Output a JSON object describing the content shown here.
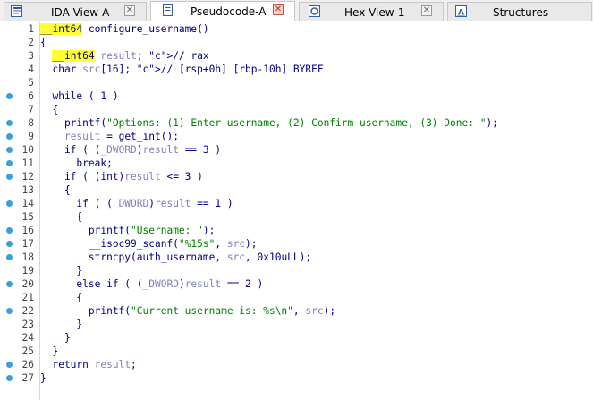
{
  "tabs": [
    {
      "label": "IDA View-A",
      "icon": "ida-view-icon",
      "active": false
    },
    {
      "label": "Pseudocode-A",
      "icon": "pseudocode-icon",
      "active": true
    },
    {
      "label": "Hex View-1",
      "icon": "hex-view-icon",
      "active": false
    },
    {
      "label": "Structures",
      "icon": "structures-icon",
      "active": false
    }
  ],
  "code": {
    "highlight_color": "#ffff33",
    "breakpoint_color": "#3aa0d8",
    "lines": [
      {
        "num": "1",
        "dot": false,
        "text": "__int64 configure_username()"
      },
      {
        "num": "2",
        "dot": false,
        "text": "{"
      },
      {
        "num": "3",
        "dot": false,
        "text": "  __int64 result; // rax"
      },
      {
        "num": "4",
        "dot": false,
        "text": "  char src[16]; // [rsp+0h] [rbp-10h] BYREF"
      },
      {
        "num": "5",
        "dot": false,
        "text": ""
      },
      {
        "num": "6",
        "dot": true,
        "text": "  while ( 1 )"
      },
      {
        "num": "7",
        "dot": false,
        "text": "  {"
      },
      {
        "num": "8",
        "dot": true,
        "text": "    printf(\"Options: (1) Enter username, (2) Confirm username, (3) Done: \");"
      },
      {
        "num": "9",
        "dot": true,
        "text": "    result = get_int();"
      },
      {
        "num": "10",
        "dot": true,
        "text": "    if ( (_DWORD)result == 3 )"
      },
      {
        "num": "11",
        "dot": true,
        "text": "      break;"
      },
      {
        "num": "12",
        "dot": true,
        "text": "    if ( (int)result <= 3 )"
      },
      {
        "num": "13",
        "dot": false,
        "text": "    {"
      },
      {
        "num": "14",
        "dot": true,
        "text": "      if ( (_DWORD)result == 1 )"
      },
      {
        "num": "15",
        "dot": false,
        "text": "      {"
      },
      {
        "num": "16",
        "dot": true,
        "text": "        printf(\"Username: \");"
      },
      {
        "num": "17",
        "dot": true,
        "text": "        __isoc99_scanf(\"%15s\", src);"
      },
      {
        "num": "18",
        "dot": true,
        "text": "        strncpy(auth_username, src, 0x10uLL);"
      },
      {
        "num": "19",
        "dot": false,
        "text": "      }"
      },
      {
        "num": "20",
        "dot": true,
        "text": "      else if ( (_DWORD)result == 2 )"
      },
      {
        "num": "21",
        "dot": false,
        "text": "      {"
      },
      {
        "num": "22",
        "dot": true,
        "text": "        printf(\"Current username is: %s\\n\", src);"
      },
      {
        "num": "23",
        "dot": false,
        "text": "      }"
      },
      {
        "num": "24",
        "dot": false,
        "text": "    }"
      },
      {
        "num": "25",
        "dot": false,
        "text": "  }"
      },
      {
        "num": "26",
        "dot": true,
        "text": "  return result;"
      },
      {
        "num": "27",
        "dot": true,
        "text": "}"
      }
    ]
  }
}
